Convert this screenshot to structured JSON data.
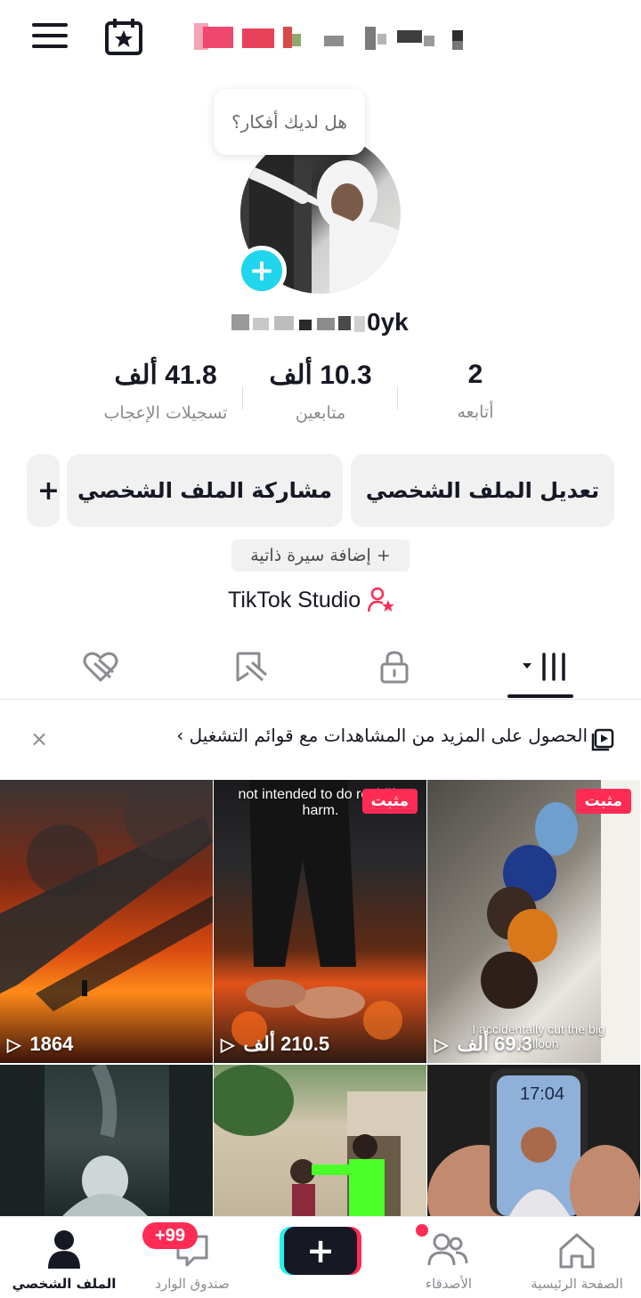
{
  "colors": {
    "accent": "#fe2c55",
    "avatar_plus": "#20d5ec",
    "text": "#161823",
    "muted": "#8a8b91"
  },
  "bubble": {
    "text": "هل لديك أفكار؟"
  },
  "profile": {
    "username_visible_tail": "0yk"
  },
  "stats": [
    {
      "value": "41.8 ألف",
      "label": "تسجيلات الإعجاب"
    },
    {
      "value": "10.3 ألف",
      "label": "متابعين"
    },
    {
      "value": "2",
      "label": "أتابعه"
    }
  ],
  "buttons": {
    "edit": "تعديل الملف الشخصي",
    "share": "مشاركة الملف الشخصي",
    "more": "+"
  },
  "bio": {
    "label": "+ إضافة سيرة ذاتية"
  },
  "studio": {
    "label": "TikTok Studio"
  },
  "tabs": [
    {
      "icon": "liked-heart-icon"
    },
    {
      "icon": "favorites-icon"
    },
    {
      "icon": "lock-icon"
    },
    {
      "icon": "videos-grid-icon",
      "active": true
    }
  ],
  "banner": {
    "text": "الحصول على المزيد من المشاهدات مع قوائم التشغيل ›",
    "close": "×"
  },
  "videos": [
    {
      "views": "1864",
      "pinned": ""
    },
    {
      "views": "210.5 ألف",
      "pinned": "مثبت",
      "overlay": "not intended to do real-life harm."
    },
    {
      "views": "69.3 ألف",
      "pinned": "مثبت",
      "overlay": "I accidentally cut the big balloon"
    },
    {
      "views": ""
    },
    {
      "views": ""
    },
    {
      "views": "",
      "overlay": "17:04"
    }
  ],
  "nav": {
    "profile": "الملف الشخصي",
    "inbox": "صندوق الوارد",
    "inbox_badge": "+99",
    "create": "+",
    "friends": "الأصدقاء",
    "home": "الصفحة الرئيسية"
  }
}
